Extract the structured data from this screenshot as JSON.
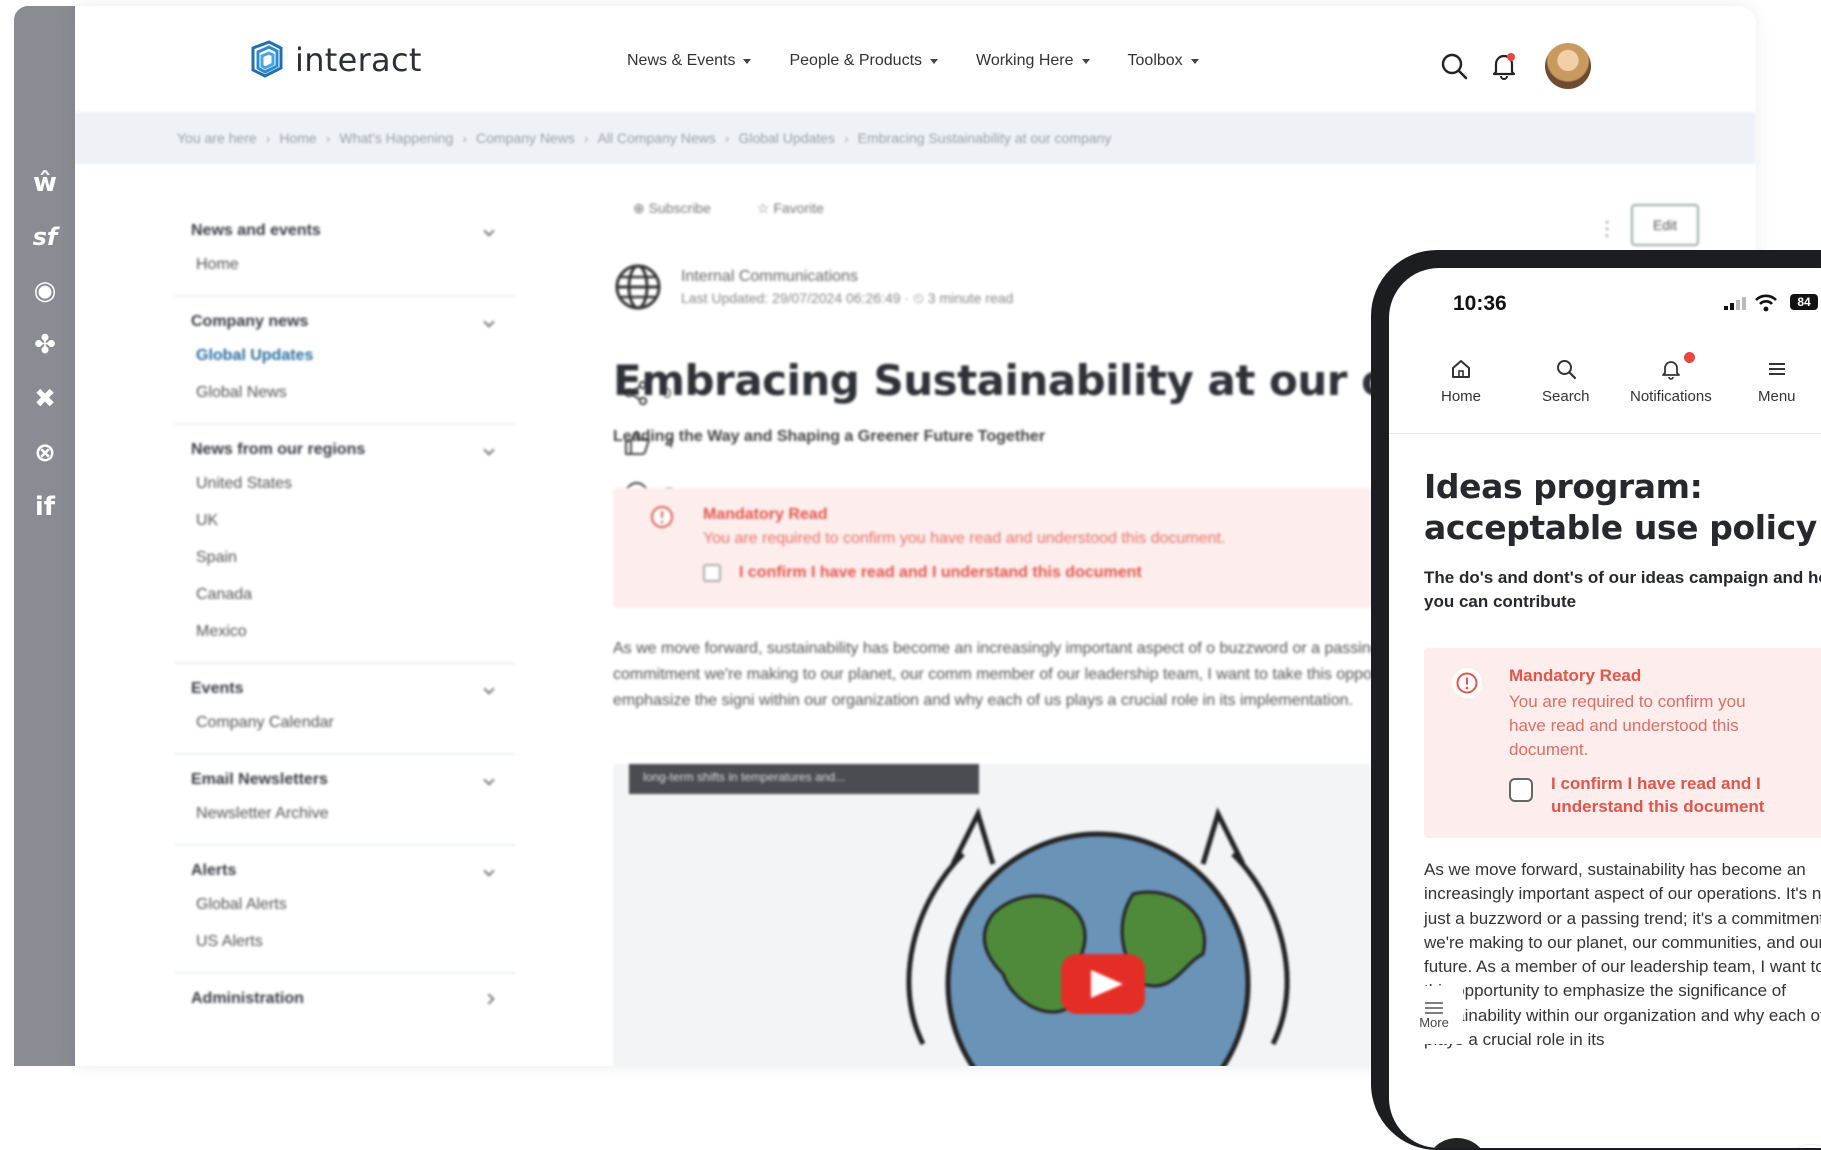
{
  "rail": {
    "icons": [
      {
        "name": "workvivo-icon",
        "glyph": "ŵ"
      },
      {
        "name": "salesforce-icon",
        "glyph": "sf"
      },
      {
        "name": "chat-app-icon",
        "glyph": "◉"
      },
      {
        "name": "slack-icon",
        "glyph": "✤"
      },
      {
        "name": "xero-icon",
        "glyph": "✖"
      },
      {
        "name": "vector-app-icon",
        "glyph": "⊗"
      },
      {
        "name": "ifttt-icon",
        "glyph": "if"
      }
    ]
  },
  "header": {
    "logo_text": "interact",
    "nav": [
      {
        "label": "News & Events"
      },
      {
        "label": "People & Products"
      },
      {
        "label": "Working Here"
      },
      {
        "label": "Toolbox"
      }
    ]
  },
  "breadcrumb": [
    "You are here",
    "Home",
    "What's Happening",
    "Company News",
    "All Company News",
    "Global Updates",
    "Embracing Sustainability at our company"
  ],
  "sidenav": [
    {
      "heading": "News and events",
      "items": [
        {
          "label": "Home"
        }
      ]
    },
    {
      "heading": "Company news",
      "items": [
        {
          "label": "Global Updates",
          "active": true
        },
        {
          "label": "Global News"
        }
      ]
    },
    {
      "heading": "News from our regions",
      "items": [
        {
          "label": "United States"
        },
        {
          "label": "UK"
        },
        {
          "label": "Spain"
        },
        {
          "label": "Canada"
        },
        {
          "label": "Mexico"
        }
      ]
    },
    {
      "heading": "Events",
      "items": [
        {
          "label": "Company Calendar"
        }
      ]
    },
    {
      "heading": "Email Newsletters",
      "items": [
        {
          "label": "Newsletter Archive"
        }
      ]
    },
    {
      "heading": "Alerts",
      "items": [
        {
          "label": "Global Alerts"
        },
        {
          "label": "US Alerts"
        }
      ]
    },
    {
      "heading": "Administration",
      "items": []
    }
  ],
  "article": {
    "subscribe": "⊕ Subscribe",
    "favorite": "☆ Favorite",
    "edit": "Edit",
    "author": "Internal Communications",
    "meta": "Last Updated: 29/07/2024 06:26:49 · ⏲ 3 minute read",
    "title": "Embracing Sustainability at our comp",
    "subtitle": "Leading the Way and Shaping a Greener Future Together",
    "alert_title": "Mandatory Read",
    "alert_body": "You are required to confirm you have read and understood this document.",
    "alert_check": "I confirm I have read and I understand this document",
    "body": "As we move forward, sustainability has become an increasingly important aspect of o buzzword or a passing trend; it's a commitment we're making to our planet, our comm member of our leadership team, I want to take this opportunity to emphasize the signi within our organization and why each of us plays a crucial role in its implementation.",
    "video_caption": "long-term shifts in temperatures and...",
    "shares": "0",
    "likes": "4",
    "comments": "3"
  },
  "phone": {
    "time": "10:36",
    "battery": "84",
    "tabs": [
      {
        "label": "Home"
      },
      {
        "label": "Search"
      },
      {
        "label": "Notifications"
      },
      {
        "label": "Menu"
      }
    ],
    "title": "Ideas program: acceptable use policy",
    "subtitle": "The do's and dont's of our ideas campaign and how you can contribute",
    "alert_title": "Mandatory Read",
    "alert_body": "You are required to confirm you have read and understood this document.",
    "alert_check": "I confirm I have read and I understand this document",
    "body": "As we move forward, sustainability has become an increasingly important aspect of our operations. It's not just a buzzword or a passing trend; it's a commitment we're making to our planet, our communities, and our future. As a member of our leadership team, I want to take this opportunity to emphasize the significance of sustainability within our organization and why each of us plays a crucial role in its",
    "more_label": "More"
  }
}
